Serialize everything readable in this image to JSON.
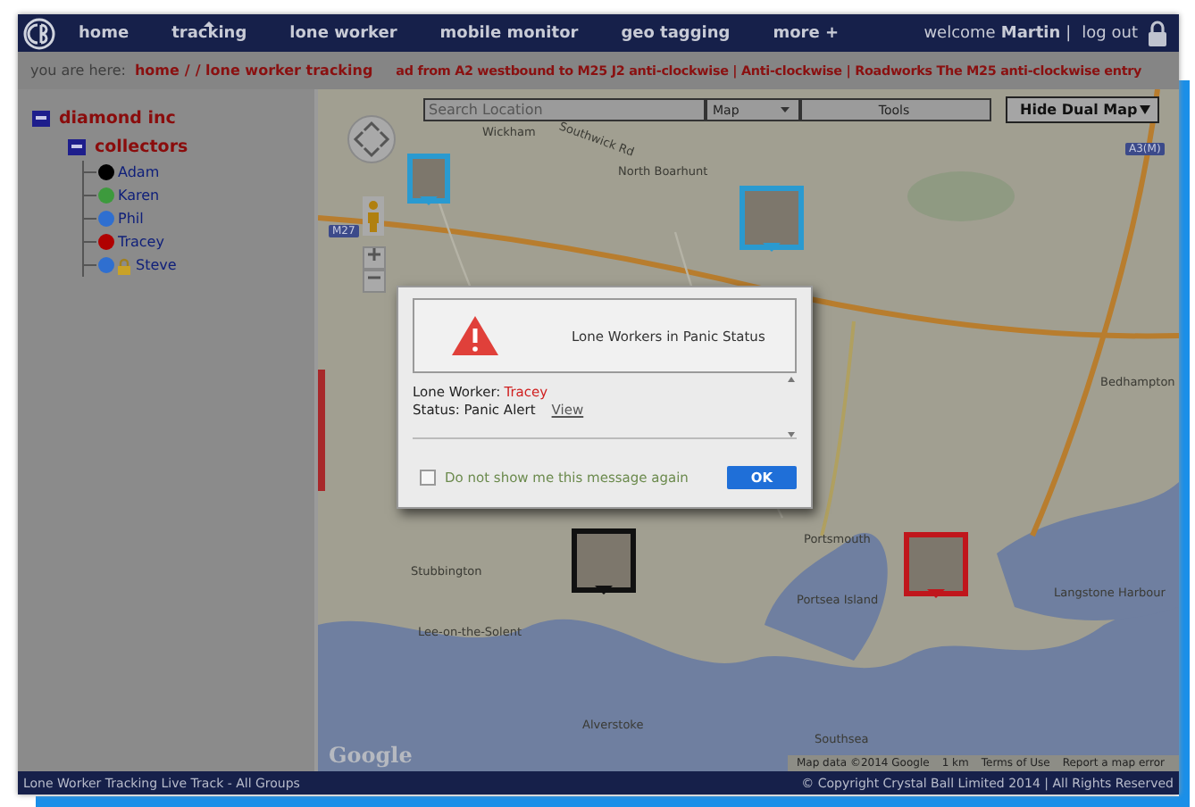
{
  "nav": {
    "items": [
      {
        "label": "home",
        "selected": false
      },
      {
        "label": "tracking",
        "selected": true
      },
      {
        "label": "lone worker",
        "selected": false
      },
      {
        "label": "mobile monitor",
        "selected": false
      },
      {
        "label": "geo tagging",
        "selected": false
      },
      {
        "label": "more +",
        "selected": false
      }
    ],
    "welcome": "welcome",
    "user": "Martin",
    "separator": "|",
    "logout": "log out"
  },
  "breadcrumb": {
    "prefix": "you are here:",
    "links": [
      "home",
      "/",
      "/ lone worker tracking"
    ],
    "ticker": "ad from A2 westbound to M25 J2 anti-clockwise | Anti-clockwise | Roadworks The M25 anti-clockwise entry"
  },
  "tree": [
    {
      "label": "diamond inc",
      "expanded": true,
      "children": [
        {
          "label": "collectors",
          "expanded": true,
          "children": [
            {
              "name": "Adam",
              "color": "#000000",
              "locked": false
            },
            {
              "name": "Karen",
              "color": "#3d9a3d",
              "locked": false
            },
            {
              "name": "Phil",
              "color": "#2f6fd0",
              "locked": false
            },
            {
              "name": "Tracey",
              "color": "#b00000",
              "locked": false
            },
            {
              "name": "Steve",
              "color": "#2f6fd0",
              "locked": true
            }
          ]
        }
      ]
    }
  ],
  "map": {
    "search": {
      "placeholder": "Search Location"
    },
    "type_select": "Map",
    "tools": "Tools",
    "dual_map": "Hide Dual Map",
    "labels": [
      "Wickham",
      "Southwick Rd",
      "North Boarhunt",
      "Bedhampton",
      "Stubbington",
      "Lee-on-the-Solent",
      "Portsmouth",
      "Portsea Island",
      "Langstone Harbour",
      "Alverstoke",
      "Southsea"
    ],
    "road_badges": [
      "A3(M)",
      "M27"
    ],
    "markers": [
      {
        "color": "#2a9ad0"
      },
      {
        "color": "#2a9ad0"
      },
      {
        "color": "#111111"
      },
      {
        "color": "#c0161c"
      }
    ],
    "attribution": [
      "Map data ©2014 Google",
      "1 km",
      "Terms of Use",
      "Report a map error"
    ],
    "logo": "Google"
  },
  "dialog": {
    "title": "Lone Workers in Panic Status",
    "worker_label": "Lone Worker:",
    "worker": "Tracey",
    "status": "Status: Panic Alert",
    "link": "View",
    "checkbox": {
      "label": "Do not show me this message again",
      "checked": false
    },
    "ok": "OK"
  },
  "footer": {
    "left": "Lone Worker Tracking Live Track - All Groups",
    "right": "© Copyright Crystal Ball Limited 2014 | All Rights Reserved"
  }
}
